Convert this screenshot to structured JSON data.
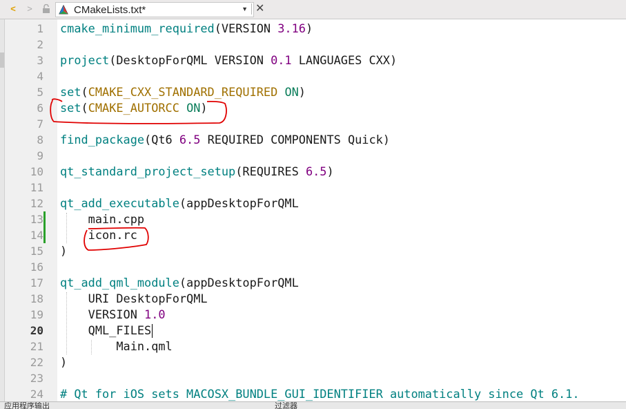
{
  "tab": {
    "filename": "CMakeLists.txt*"
  },
  "editor": {
    "current_line": 20,
    "lines": [
      {
        "n": "1"
      },
      {
        "n": "2"
      },
      {
        "n": "3"
      },
      {
        "n": "4"
      },
      {
        "n": "5"
      },
      {
        "n": "6"
      },
      {
        "n": "7"
      },
      {
        "n": "8"
      },
      {
        "n": "9"
      },
      {
        "n": "10"
      },
      {
        "n": "11"
      },
      {
        "n": "12"
      },
      {
        "n": "13"
      },
      {
        "n": "14"
      },
      {
        "n": "15"
      },
      {
        "n": "16"
      },
      {
        "n": "17"
      },
      {
        "n": "18"
      },
      {
        "n": "19"
      },
      {
        "n": "20"
      },
      {
        "n": "21"
      },
      {
        "n": "22"
      },
      {
        "n": "23"
      },
      {
        "n": "24"
      }
    ],
    "code": {
      "l1": {
        "fn": "cmake_minimum_required",
        "a": "(VERSION ",
        "num": "3.16",
        "b": ")"
      },
      "l3": {
        "fn": "project",
        "a": "(DesktopForQML VERSION ",
        "num": "0.1",
        "b": " LANGUAGES CXX)"
      },
      "l5": {
        "fn": "set",
        "a": "(",
        "kw": "CMAKE_CXX_STANDARD_REQUIRED",
        "sp": " ",
        "on": "ON",
        "b": ")"
      },
      "l6": {
        "fn": "set",
        "a": "(",
        "kw": "CMAKE_AUTORCC",
        "sp": " ",
        "on": "ON",
        "b": ")"
      },
      "l8": {
        "fn": "find_package",
        "a": "(Qt6 ",
        "num": "6.5",
        "b": " REQUIRED COMPONENTS Quick)"
      },
      "l10": {
        "fn": "qt_standard_project_setup",
        "a": "(REQUIRES ",
        "num": "6.5",
        "b": ")"
      },
      "l12": {
        "fn": "qt_add_executable",
        "a": "(appDesktopForQML"
      },
      "l13": {
        "text": "    main.cpp"
      },
      "l14": {
        "text": "    icon.rc"
      },
      "l15": {
        "text": ")"
      },
      "l17": {
        "fn": "qt_add_qml_module",
        "a": "(appDesktopForQML"
      },
      "l18": {
        "text": "    URI DesktopForQML"
      },
      "l19": {
        "a": "    VERSION ",
        "num": "1.0"
      },
      "l20": {
        "text": "    QML_FILES"
      },
      "l21": {
        "text": "        Main.qml"
      },
      "l22": {
        "text": ")"
      },
      "l24": {
        "text": "# Qt for iOS sets MACOSX_BUNDLE_GUI_IDENTIFIER automatically since Qt 6.1."
      }
    }
  },
  "bottom": {
    "label": "应用程序输出",
    "filter": "过滤器"
  },
  "colors": {
    "function": "#008080",
    "number": "#800080",
    "variable": "#a07000",
    "on_value": "#0a7d5a",
    "annotation": "#e00000",
    "modified_marker": "#2aa02a"
  }
}
